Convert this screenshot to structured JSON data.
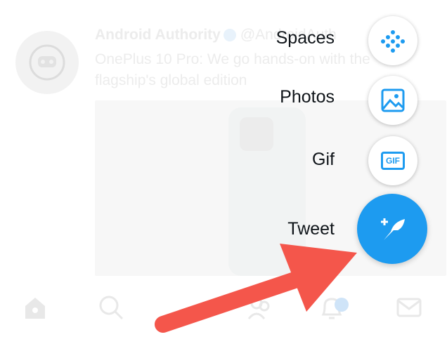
{
  "background": {
    "tweet": {
      "author": "Android Authority",
      "handle": "@AndroidAuth",
      "text": "OnePlus 10 Pro: We go hands-on with the flagship's global edition"
    }
  },
  "fab_menu": {
    "items": [
      {
        "label": "Spaces",
        "icon": "spaces-icon"
      },
      {
        "label": "Photos",
        "icon": "image-icon"
      },
      {
        "label": "Gif",
        "icon": "gif-icon"
      },
      {
        "label": "Tweet",
        "icon": "compose-tweet-icon"
      }
    ],
    "gif_text": "GIF"
  },
  "tabbar": {
    "items": [
      "home-icon",
      "search-icon",
      "communities-icon",
      "notifications-icon",
      "messages-icon"
    ]
  },
  "colors": {
    "accent": "#1d9bf0",
    "arrow": "#f4564b"
  }
}
